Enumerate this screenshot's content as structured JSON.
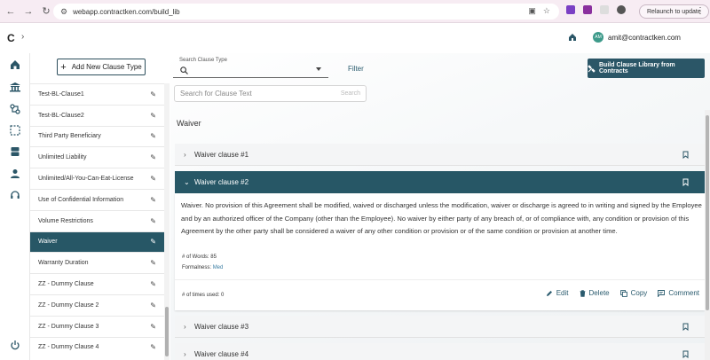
{
  "browser": {
    "url": "webapp.contractken.com/build_lib",
    "relaunch_label": "Relaunch to update"
  },
  "app": {
    "brand_letter": "C",
    "user": {
      "initials": "AM",
      "email": "amit@contractken.com"
    }
  },
  "toolbar": {
    "add_clause_type_label": "Add New Clause Type",
    "search_clause_type_label": "Search Clause Type",
    "filter_label": "Filter",
    "build_library_label": "Build Clause Library from Contracts",
    "search_text_placeholder": "Search for Clause Text",
    "search_button_label": "Search"
  },
  "clause_list": {
    "items": [
      {
        "label": "Test-BL-Clause1"
      },
      {
        "label": "Test-BL-Clause2"
      },
      {
        "label": "Third Party Beneficiary"
      },
      {
        "label": "Unlimited Liability"
      },
      {
        "label": "Unlimited/All-You-Can-Eat-License"
      },
      {
        "label": "Use of Confidential Information"
      },
      {
        "label": "Volume Restrictions"
      },
      {
        "label": "Waiver",
        "selected": true
      },
      {
        "label": "Warranty Duration"
      },
      {
        "label": "ZZ - Dummy Clause"
      },
      {
        "label": "ZZ - Dummy Clause 2"
      },
      {
        "label": "ZZ - Dummy Clause 3"
      },
      {
        "label": "ZZ - Dummy Clause 4"
      }
    ]
  },
  "main": {
    "section_title": "Waiver",
    "clauses": [
      {
        "title": "Waiver clause #1"
      },
      {
        "title": "Waiver clause #2",
        "text": "Waiver. No provision of this Agreement shall be modified, waived or discharged unless the modification, waiver or discharge is agreed to in writing and signed by the Employee and by an authorized officer of the Company (other than the Employee). No waiver by either party of any breach of, or of compliance with, any condition or provision of this Agreement by the other party shall be considered a waiver of any other condition or provision or of the same condition or provision at another time.",
        "words_label": "# of Words: 85",
        "formalness_label": "Formalness:",
        "formalness_value": "Med",
        "times_used_label": "# of times used: 0",
        "actions": {
          "edit": "Edit",
          "delete": "Delete",
          "copy": "Copy",
          "comment": "Comment"
        }
      },
      {
        "title": "Waiver clause #3"
      },
      {
        "title": "Waiver clause #4"
      }
    ]
  },
  "colors": {
    "primary": "#275766",
    "link": "#3a7da3"
  }
}
